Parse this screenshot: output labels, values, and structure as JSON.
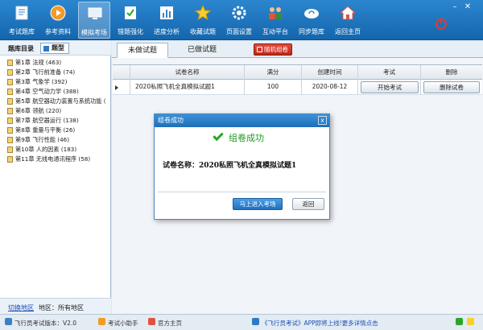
{
  "toolbar": {
    "items": [
      {
        "label": "考试题库",
        "icon": "exam-bank-icon"
      },
      {
        "label": "参考资料",
        "icon": "reference-icon"
      },
      {
        "label": "模拟考场",
        "icon": "mock-exam-icon",
        "active": true
      },
      {
        "label": "错题强化",
        "icon": "mistakes-icon"
      },
      {
        "label": "进度分析",
        "icon": "progress-chart-icon"
      },
      {
        "label": "收藏试题",
        "icon": "star-icon"
      },
      {
        "label": "页面设置",
        "icon": "gear-icon"
      },
      {
        "label": "互动平台",
        "icon": "users-icon"
      },
      {
        "label": "同步题库",
        "icon": "sync-cloud-icon"
      },
      {
        "label": "返回主页",
        "icon": "home-icon"
      }
    ],
    "colors": {
      "bar": "#1c74bf",
      "power": "#e23a2f"
    }
  },
  "left": {
    "title": "题库目录",
    "type_button": "题型",
    "chapters": [
      "第1章 法规 (463)",
      "第2章 飞行前准备 (74)",
      "第3章 气象学 (392)",
      "第4章 空气动力学 (388)",
      "第5章 航空器动力装置与系统功能 (",
      "第6章 领航 (220)",
      "第7章 航空器运行 (138)",
      "第8章 重量与平衡 (26)",
      "第9章 飞行性能 (46)",
      "第10章 人的因素 (183)",
      "第11章 无线电通讯程序 (58)"
    ],
    "switch_region": "切换地区",
    "region": "地区：所有地区"
  },
  "main": {
    "tabs": [
      "未做试题",
      "已做试题"
    ],
    "random_button": "随机组卷",
    "columns": [
      "试卷名称",
      "满分",
      "创建时间",
      "考试",
      "删除"
    ],
    "rows": [
      {
        "name": "2020私照飞机全真模拟试题1",
        "score": "100",
        "date": "2020-08-12",
        "exam_btn": "开始考试",
        "delete_btn": "删除试卷"
      }
    ]
  },
  "dialog": {
    "title": "组卷成功",
    "close": "x",
    "status": "组卷成功",
    "paper_line": "试卷名称：2020私照飞机全真模拟试题1",
    "enter_button": "马上进入考场",
    "back_button": "返回"
  },
  "statusbar": {
    "version": "飞行员考试版本：V2.0",
    "helper": "考试小助手",
    "official": "官方主页",
    "app_notice": "《飞行员考试》APP即将上线!更多详情点击"
  }
}
